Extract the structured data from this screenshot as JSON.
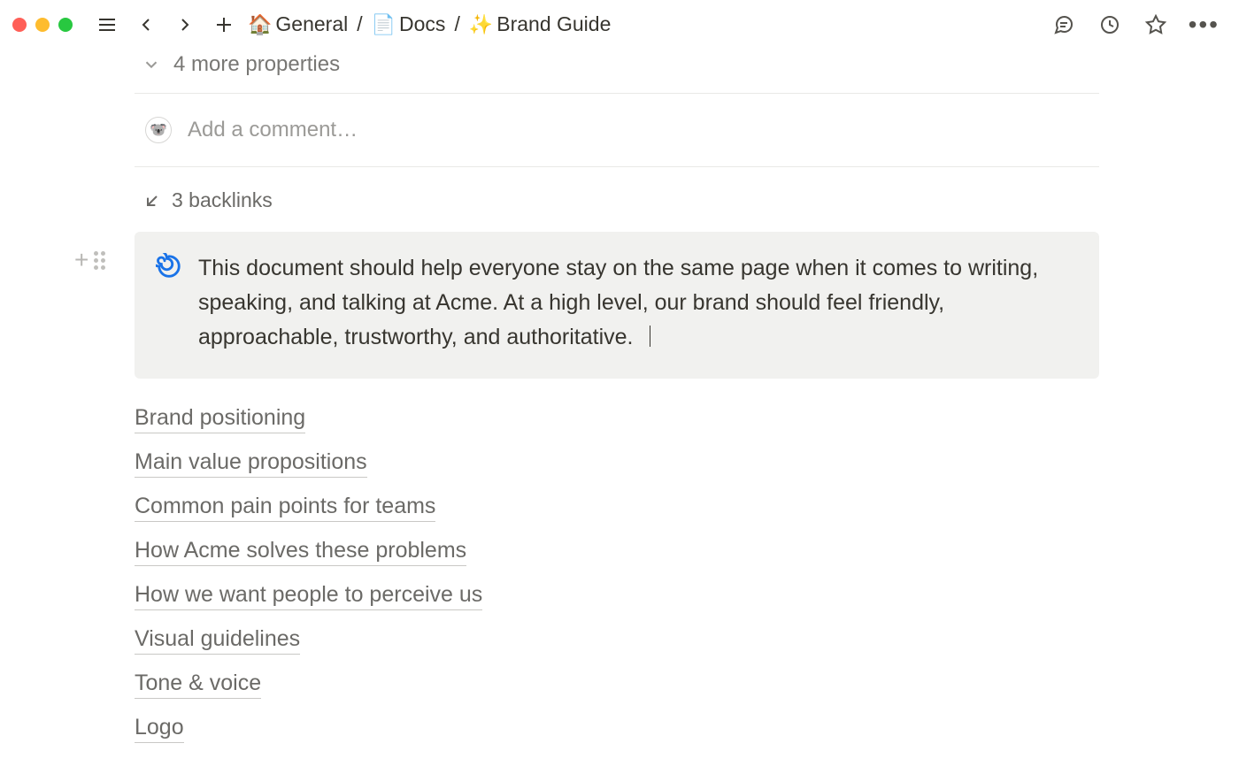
{
  "breadcrumb": {
    "items": [
      {
        "icon": "🏠",
        "label": "General"
      },
      {
        "icon": "📄",
        "label": "Docs"
      },
      {
        "icon": "✨",
        "label": "Brand Guide"
      }
    ]
  },
  "properties": {
    "more_label": "4 more properties"
  },
  "comment": {
    "placeholder": "Add a comment…",
    "avatar_emoji": "🐨"
  },
  "backlinks": {
    "label": "3 backlinks"
  },
  "callout": {
    "text": "This document should help everyone stay on the same page when it comes to writing, speaking, and talking at Acme. At a high level, our brand should feel friendly, approachable, trustworthy, and authoritative."
  },
  "toc": {
    "items": [
      "Brand positioning",
      "Main value propositions",
      "Common pain points for teams",
      "How Acme solves these problems",
      "How we want people to perceive us",
      "Visual guidelines",
      "Tone & voice",
      "Logo"
    ]
  }
}
